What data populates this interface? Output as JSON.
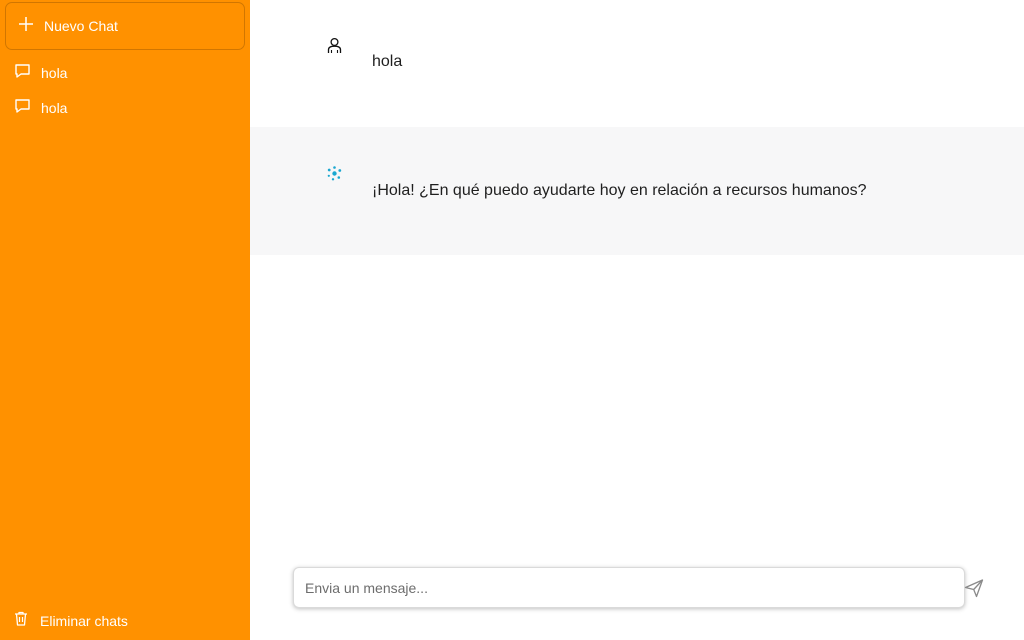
{
  "sidebar": {
    "new_chat_label": "Nuevo Chat",
    "chats": [
      {
        "label": "hola"
      },
      {
        "label": "hola"
      }
    ],
    "delete_label": "Eliminar chats"
  },
  "messages": [
    {
      "role": "user",
      "icon": "user-icon",
      "text": "hola"
    },
    {
      "role": "assistant",
      "icon": "bot-logo-icon",
      "text": "¡Hola! ¿En qué puedo ayudarte hoy en relación a recursos humanos?"
    }
  ],
  "composer": {
    "placeholder": "Envia un mensaje..."
  },
  "colors": {
    "sidebar_bg": "#ff9100",
    "assistant_row_bg": "#f7f7f8",
    "bot_icon": "#1aa7d0"
  }
}
